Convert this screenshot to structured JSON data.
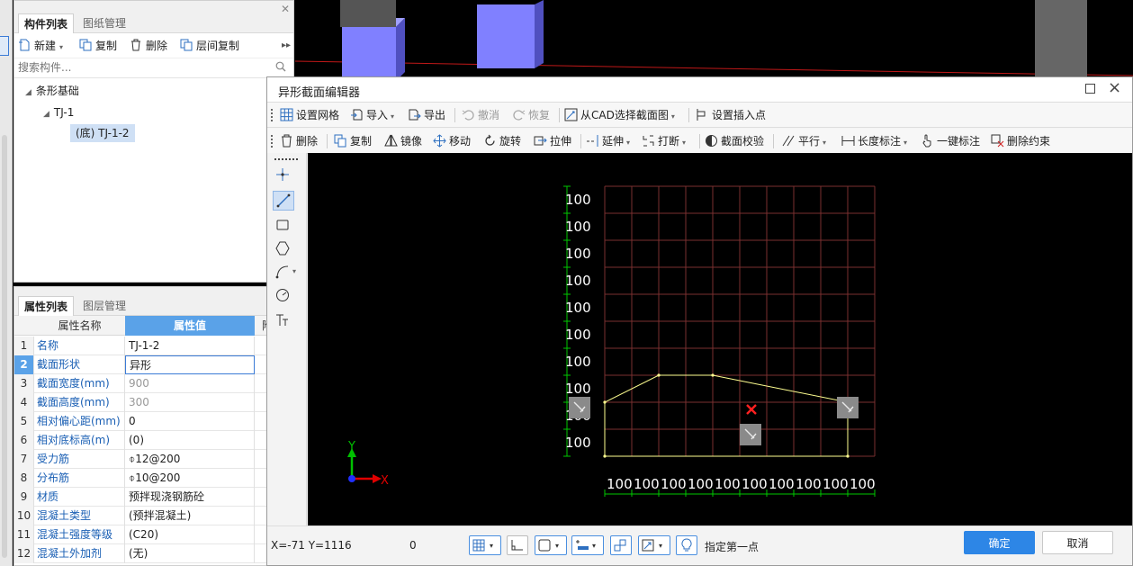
{
  "component_panel": {
    "tabs": [
      "构件列表",
      "图纸管理"
    ],
    "toolbar": {
      "new": "新建",
      "copy": "复制",
      "delete": "删除",
      "floor_copy": "层间复制"
    },
    "search_placeholder": "搜索构件...",
    "tree": {
      "root": "条形基础",
      "child": "TJ-1",
      "leaf": "(底) TJ-1-2"
    }
  },
  "property_panel": {
    "tabs": [
      "属性列表",
      "图层管理"
    ],
    "headers": {
      "name": "属性名称",
      "value": "属性值",
      "extra": "附"
    },
    "rows": [
      {
        "num": "1",
        "name": "名称",
        "value": "TJ-1-2"
      },
      {
        "num": "2",
        "name": "截面形状",
        "value": "异形"
      },
      {
        "num": "3",
        "name": "截面宽度(mm)",
        "value": "900"
      },
      {
        "num": "4",
        "name": "截面高度(mm)",
        "value": "300"
      },
      {
        "num": "5",
        "name": "相对偏心距(mm)",
        "value": "0"
      },
      {
        "num": "6",
        "name": "相对底标高(m)",
        "value": "(0)"
      },
      {
        "num": "7",
        "name": "受力筋",
        "value": "⌽12@200"
      },
      {
        "num": "8",
        "name": "分布筋",
        "value": "⌽10@200"
      },
      {
        "num": "9",
        "name": "材质",
        "value": "预拌现浇钢筋砼"
      },
      {
        "num": "10",
        "name": "混凝土类型",
        "value": "(预拌混凝土)"
      },
      {
        "num": "11",
        "name": "混凝土强度等级",
        "value": "(C20)"
      },
      {
        "num": "12",
        "name": "混凝土外加剂",
        "value": "(无)"
      }
    ]
  },
  "editor": {
    "title": "异形截面编辑器",
    "toolbar1": {
      "grid": "设置网格",
      "import": "导入",
      "export": "导出",
      "undo": "撤消",
      "redo": "恢复",
      "from_cad": "从CAD选择截面图",
      "insert_point": "设置插入点"
    },
    "toolbar2": {
      "delete": "删除",
      "copy": "复制",
      "mirror": "镜像",
      "move": "移动",
      "rotate": "旋转",
      "stretch": "拉伸",
      "extend": "延伸",
      "break": "打断",
      "check": "截面校验",
      "parallel": "平行",
      "length_dim": "长度标注",
      "auto_dim": "一键标注",
      "delete_constraint": "删除约束"
    },
    "canvas": {
      "row_labels": [
        "100",
        "100",
        "100",
        "100",
        "100",
        "100",
        "100",
        "100",
        "100",
        "100"
      ],
      "col_labels": [
        "100",
        "100",
        "100",
        "100",
        "100",
        "100",
        "100",
        "100",
        "100",
        "100"
      ],
      "axis_x": "X",
      "axis_y": "Y",
      "colors": {
        "grid": "#7a3030",
        "shape": "#ffff90",
        "label": "#ffffff",
        "dim": "#00c800",
        "marker": "#ff2020"
      }
    },
    "status": {
      "coords": "X=-71 Y=1116",
      "value": "0",
      "hint": "指定第一点",
      "ok": "确定",
      "cancel": "取消"
    }
  }
}
